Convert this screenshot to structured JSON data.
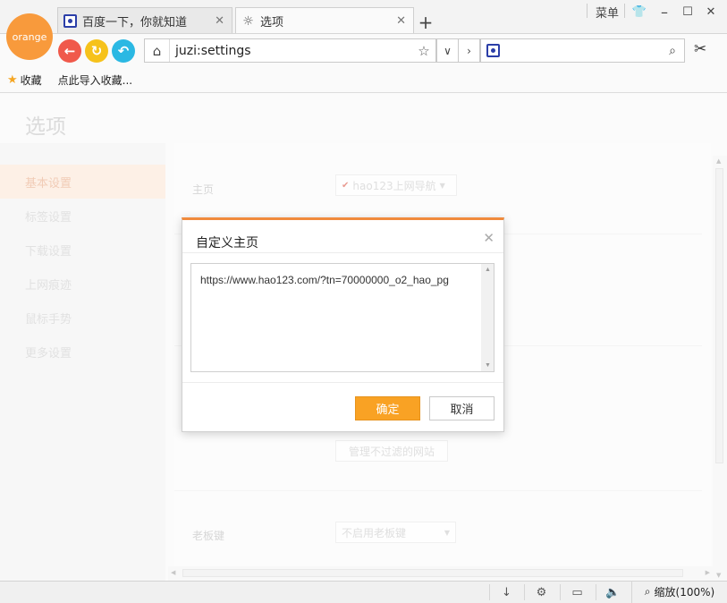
{
  "browser": {
    "logo_text": "orange",
    "tabs": [
      {
        "title": "百度一下，你就知道"
      },
      {
        "title": "选项"
      }
    ],
    "menu_label": "菜单",
    "address_url": "juzi:settings",
    "search_placeholder": ""
  },
  "bookmarks": [
    {
      "label": "收藏"
    },
    {
      "label": "点此导入收藏..."
    }
  ],
  "page": {
    "title": "选项",
    "nav": [
      {
        "label": "基本设置",
        "active": true
      },
      {
        "label": "标签设置"
      },
      {
        "label": "下载设置"
      },
      {
        "label": "上网痕迹"
      },
      {
        "label": "鼠标手势"
      },
      {
        "label": "更多设置"
      }
    ],
    "homepage_label": "主页",
    "homepage_select": "hao123上网导航",
    "manage_filter_button": "管理不过滤的网站",
    "boss_key_label": "老板键",
    "boss_key_select": "不启用老板键"
  },
  "dialog": {
    "title": "自定义主页",
    "textarea_value": "https://www.hao123.com/?tn=70000000_o2_hao_pg",
    "ok_label": "确定",
    "cancel_label": "取消"
  },
  "statusbar": {
    "zoom_label": "缩放(100%)"
  },
  "colors": {
    "accent": "#f89a3c",
    "ok_button": "#f9a224",
    "back_button": "#f0594b",
    "refresh_button": "#f6c21b",
    "undo_button": "#2bb8e3"
  }
}
